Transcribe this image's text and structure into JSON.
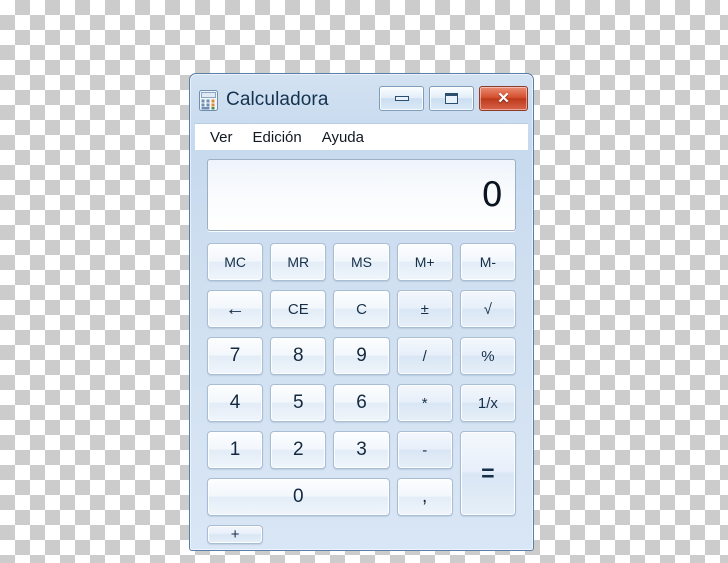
{
  "window": {
    "title": "Calculadora",
    "icon": "calculator-icon",
    "controls": {
      "minimize": "minimize-icon",
      "maximize": "maximize-icon",
      "close": "✕"
    }
  },
  "menu": {
    "items": [
      {
        "label": "Ver"
      },
      {
        "label": "Edición"
      },
      {
        "label": "Ayuda"
      }
    ]
  },
  "display": {
    "value": "0"
  },
  "keypad": {
    "memory_row": [
      {
        "label": "MC",
        "name": "memory-clear-button"
      },
      {
        "label": "MR",
        "name": "memory-recall-button"
      },
      {
        "label": "MS",
        "name": "memory-store-button"
      },
      {
        "label": "M+",
        "name": "memory-add-button"
      },
      {
        "label": "M-",
        "name": "memory-subtract-button"
      }
    ],
    "edit_row": [
      {
        "label": "←",
        "name": "backspace-button"
      },
      {
        "label": "CE",
        "name": "clear-entry-button"
      },
      {
        "label": "C",
        "name": "clear-button"
      },
      {
        "label": "±",
        "name": "sign-toggle-button"
      },
      {
        "label": "√",
        "name": "square-root-button"
      }
    ],
    "row_789": [
      {
        "label": "7",
        "name": "digit-7-button"
      },
      {
        "label": "8",
        "name": "digit-8-button"
      },
      {
        "label": "9",
        "name": "digit-9-button"
      },
      {
        "label": "/",
        "name": "divide-button"
      },
      {
        "label": "%",
        "name": "percent-button"
      }
    ],
    "row_456": [
      {
        "label": "4",
        "name": "digit-4-button"
      },
      {
        "label": "5",
        "name": "digit-5-button"
      },
      {
        "label": "6",
        "name": "digit-6-button"
      },
      {
        "label": "*",
        "name": "multiply-button"
      },
      {
        "label": "1/x",
        "name": "reciprocal-button"
      }
    ],
    "row_123": [
      {
        "label": "1",
        "name": "digit-1-button"
      },
      {
        "label": "2",
        "name": "digit-2-button"
      },
      {
        "label": "3",
        "name": "digit-3-button"
      },
      {
        "label": "-",
        "name": "subtract-button"
      }
    ],
    "row_bottom": [
      {
        "label": "0",
        "name": "digit-0-button"
      },
      {
        "label": ",",
        "name": "decimal-separator-button"
      },
      {
        "label": "+",
        "name": "add-button"
      }
    ],
    "equals": {
      "label": "=",
      "name": "equals-button"
    }
  },
  "colors": {
    "window_frame": "#5b7fa6",
    "title_bar": "#cfdff0",
    "close_button": "#bd3a1c",
    "key_face": "#eff5fb",
    "text": "#17304a"
  }
}
